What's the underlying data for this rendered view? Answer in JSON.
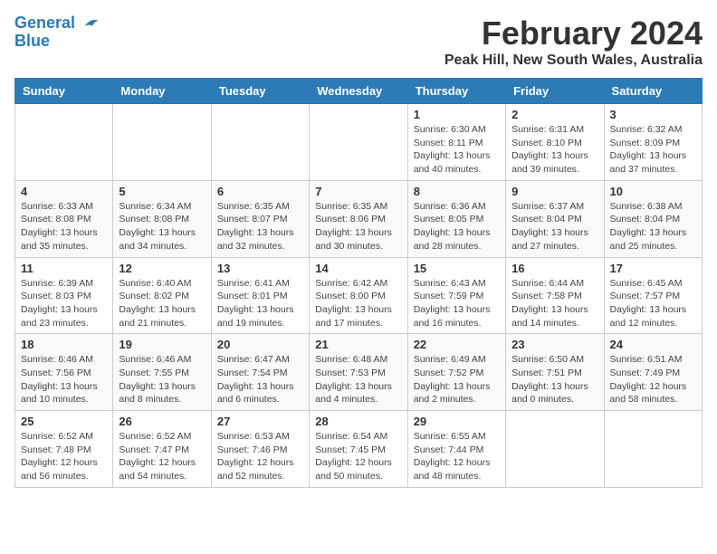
{
  "header": {
    "logo_line1": "General",
    "logo_line2": "Blue",
    "title": "February 2024",
    "subtitle": "Peak Hill, New South Wales, Australia"
  },
  "days_of_week": [
    "Sunday",
    "Monday",
    "Tuesday",
    "Wednesday",
    "Thursday",
    "Friday",
    "Saturday"
  ],
  "weeks": [
    [
      {
        "day": "",
        "info": ""
      },
      {
        "day": "",
        "info": ""
      },
      {
        "day": "",
        "info": ""
      },
      {
        "day": "",
        "info": ""
      },
      {
        "day": "1",
        "info": "Sunrise: 6:30 AM\nSunset: 8:11 PM\nDaylight: 13 hours\nand 40 minutes."
      },
      {
        "day": "2",
        "info": "Sunrise: 6:31 AM\nSunset: 8:10 PM\nDaylight: 13 hours\nand 39 minutes."
      },
      {
        "day": "3",
        "info": "Sunrise: 6:32 AM\nSunset: 8:09 PM\nDaylight: 13 hours\nand 37 minutes."
      }
    ],
    [
      {
        "day": "4",
        "info": "Sunrise: 6:33 AM\nSunset: 8:08 PM\nDaylight: 13 hours\nand 35 minutes."
      },
      {
        "day": "5",
        "info": "Sunrise: 6:34 AM\nSunset: 8:08 PM\nDaylight: 13 hours\nand 34 minutes."
      },
      {
        "day": "6",
        "info": "Sunrise: 6:35 AM\nSunset: 8:07 PM\nDaylight: 13 hours\nand 32 minutes."
      },
      {
        "day": "7",
        "info": "Sunrise: 6:35 AM\nSunset: 8:06 PM\nDaylight: 13 hours\nand 30 minutes."
      },
      {
        "day": "8",
        "info": "Sunrise: 6:36 AM\nSunset: 8:05 PM\nDaylight: 13 hours\nand 28 minutes."
      },
      {
        "day": "9",
        "info": "Sunrise: 6:37 AM\nSunset: 8:04 PM\nDaylight: 13 hours\nand 27 minutes."
      },
      {
        "day": "10",
        "info": "Sunrise: 6:38 AM\nSunset: 8:04 PM\nDaylight: 13 hours\nand 25 minutes."
      }
    ],
    [
      {
        "day": "11",
        "info": "Sunrise: 6:39 AM\nSunset: 8:03 PM\nDaylight: 13 hours\nand 23 minutes."
      },
      {
        "day": "12",
        "info": "Sunrise: 6:40 AM\nSunset: 8:02 PM\nDaylight: 13 hours\nand 21 minutes."
      },
      {
        "day": "13",
        "info": "Sunrise: 6:41 AM\nSunset: 8:01 PM\nDaylight: 13 hours\nand 19 minutes."
      },
      {
        "day": "14",
        "info": "Sunrise: 6:42 AM\nSunset: 8:00 PM\nDaylight: 13 hours\nand 17 minutes."
      },
      {
        "day": "15",
        "info": "Sunrise: 6:43 AM\nSunset: 7:59 PM\nDaylight: 13 hours\nand 16 minutes."
      },
      {
        "day": "16",
        "info": "Sunrise: 6:44 AM\nSunset: 7:58 PM\nDaylight: 13 hours\nand 14 minutes."
      },
      {
        "day": "17",
        "info": "Sunrise: 6:45 AM\nSunset: 7:57 PM\nDaylight: 13 hours\nand 12 minutes."
      }
    ],
    [
      {
        "day": "18",
        "info": "Sunrise: 6:46 AM\nSunset: 7:56 PM\nDaylight: 13 hours\nand 10 minutes."
      },
      {
        "day": "19",
        "info": "Sunrise: 6:46 AM\nSunset: 7:55 PM\nDaylight: 13 hours\nand 8 minutes."
      },
      {
        "day": "20",
        "info": "Sunrise: 6:47 AM\nSunset: 7:54 PM\nDaylight: 13 hours\nand 6 minutes."
      },
      {
        "day": "21",
        "info": "Sunrise: 6:48 AM\nSunset: 7:53 PM\nDaylight: 13 hours\nand 4 minutes."
      },
      {
        "day": "22",
        "info": "Sunrise: 6:49 AM\nSunset: 7:52 PM\nDaylight: 13 hours\nand 2 minutes."
      },
      {
        "day": "23",
        "info": "Sunrise: 6:50 AM\nSunset: 7:51 PM\nDaylight: 13 hours\nand 0 minutes."
      },
      {
        "day": "24",
        "info": "Sunrise: 6:51 AM\nSunset: 7:49 PM\nDaylight: 12 hours\nand 58 minutes."
      }
    ],
    [
      {
        "day": "25",
        "info": "Sunrise: 6:52 AM\nSunset: 7:48 PM\nDaylight: 12 hours\nand 56 minutes."
      },
      {
        "day": "26",
        "info": "Sunrise: 6:52 AM\nSunset: 7:47 PM\nDaylight: 12 hours\nand 54 minutes."
      },
      {
        "day": "27",
        "info": "Sunrise: 6:53 AM\nSunset: 7:46 PM\nDaylight: 12 hours\nand 52 minutes."
      },
      {
        "day": "28",
        "info": "Sunrise: 6:54 AM\nSunset: 7:45 PM\nDaylight: 12 hours\nand 50 minutes."
      },
      {
        "day": "29",
        "info": "Sunrise: 6:55 AM\nSunset: 7:44 PM\nDaylight: 12 hours\nand 48 minutes."
      },
      {
        "day": "",
        "info": ""
      },
      {
        "day": "",
        "info": ""
      }
    ]
  ]
}
